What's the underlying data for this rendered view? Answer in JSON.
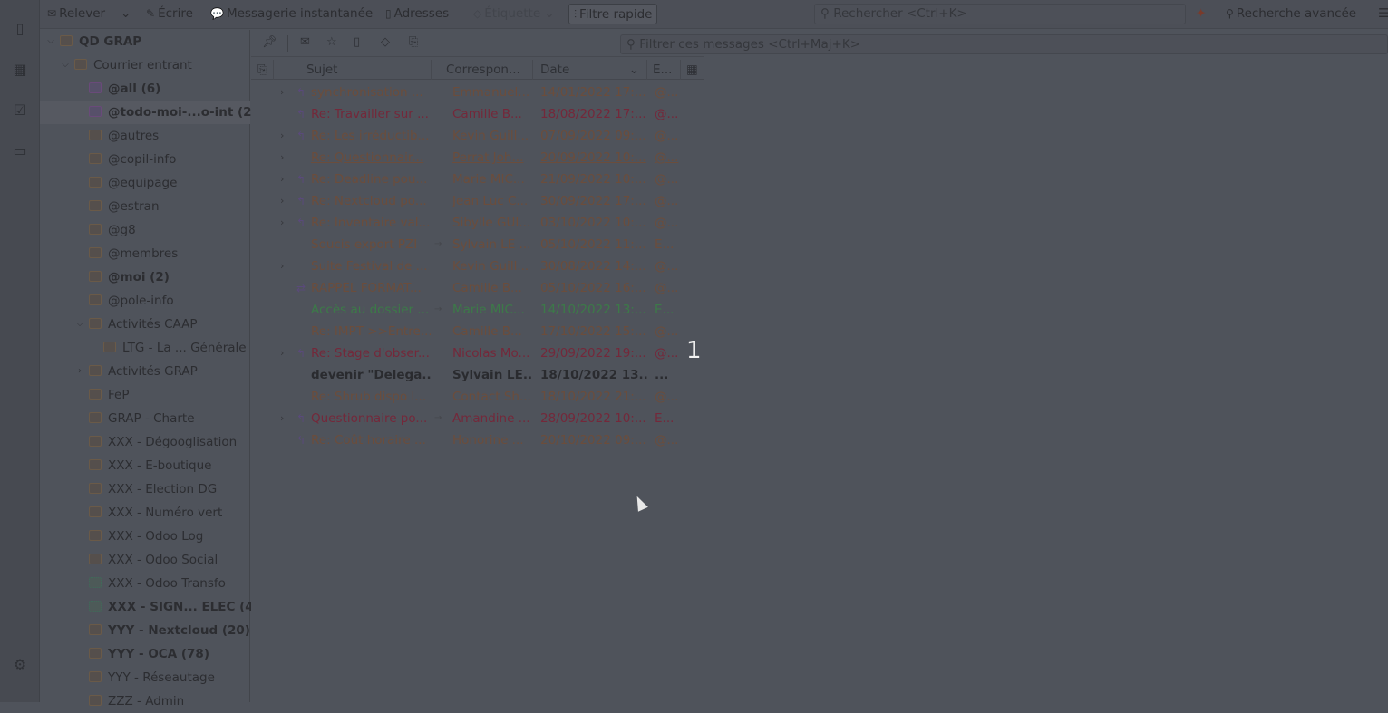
{
  "toolbar": {
    "get_mail": "Relever",
    "write": "Écrire",
    "chat": "Messagerie instantanée",
    "addresses": "Adresses",
    "tag": "Étiquette",
    "quick_filter": "Filtre rapide",
    "search_placeholder": "Rechercher <Ctrl+K>",
    "advanced_search": "Recherche avancée"
  },
  "folders": [
    {
      "label": "QD GRAP",
      "level": 0,
      "twisty": "open",
      "icon": "account",
      "bold": true
    },
    {
      "label": "Courrier entrant",
      "level": 1,
      "twisty": "open",
      "icon": "account"
    },
    {
      "label": "@all (6)",
      "level": 2,
      "icon": "purple",
      "bold": true
    },
    {
      "label": "@todo-moi-...o-int (2)",
      "level": 2,
      "icon": "purple",
      "bold": true,
      "selected": true
    },
    {
      "label": "@autres",
      "level": 2
    },
    {
      "label": "@copil-info",
      "level": 2
    },
    {
      "label": "@equipage",
      "level": 2
    },
    {
      "label": "@estran",
      "level": 2
    },
    {
      "label": "@g8",
      "level": 2
    },
    {
      "label": "@membres",
      "level": 2
    },
    {
      "label": "@moi (2)",
      "level": 2,
      "bold": true
    },
    {
      "label": "@pole-info",
      "level": 2
    },
    {
      "label": "Activités CAAP",
      "level": 2,
      "twisty": "open"
    },
    {
      "label": "LTG - La ... Générale",
      "level": 3
    },
    {
      "label": "Activités GRAP",
      "level": 2,
      "twisty": "closed"
    },
    {
      "label": "FeP",
      "level": 2
    },
    {
      "label": "GRAP - Charte",
      "level": 2
    },
    {
      "label": "XXX - Dégooglisation",
      "level": 2
    },
    {
      "label": "XXX - E-boutique",
      "level": 2
    },
    {
      "label": "XXX - Election DG",
      "level": 2
    },
    {
      "label": "XXX - Numéro vert",
      "level": 2
    },
    {
      "label": "XXX - Odoo Log",
      "level": 2
    },
    {
      "label": "XXX - Odoo Social",
      "level": 2
    },
    {
      "label": "XXX - Odoo Transfo",
      "level": 2,
      "icon": "green"
    },
    {
      "label": "XXX - SIGN... ELEC (4)",
      "level": 2,
      "icon": "green",
      "bold": true
    },
    {
      "label": "YYY - Nextcloud (20)",
      "level": 2,
      "bold": true
    },
    {
      "label": "YYY - OCA (78)",
      "level": 2,
      "bold": true
    },
    {
      "label": "YYY - Réseautage",
      "level": 2
    },
    {
      "label": "ZZZ - Admin",
      "level": 2
    }
  ],
  "list": {
    "filter_placeholder": "Filtrer ces messages <Ctrl+Maj+K>",
    "columns": {
      "subject": "Sujet",
      "correspondent": "Correspon...",
      "date": "Date",
      "email": "E..."
    },
    "rows": [
      {
        "subject": "synchronisation ...",
        "correspondent": "Emmanuel...",
        "date": "14/01/2022 17:...",
        "email": "@...",
        "thread": true,
        "status": "replied"
      },
      {
        "subject": "Re: Travailler sur ...",
        "correspondent": "Camille B...",
        "date": "18/08/2022 17:...",
        "email": "@...",
        "status": "replied",
        "style": "red"
      },
      {
        "subject": "Re: Les irréductib...",
        "correspondent": "Kevin Guill...",
        "date": "07/09/2022 09:...",
        "email": "@...",
        "thread": true,
        "status": "replied"
      },
      {
        "subject": "Re: Questionnair...",
        "correspondent": "Perrat Joh...",
        "date": "20/09/2022 10:...",
        "email": "@...",
        "thread": true,
        "style": "under"
      },
      {
        "subject": "Re: Deadline pou...",
        "correspondent": "Marie MIC...",
        "date": "21/09/2022 10:...",
        "email": "@...",
        "thread": true,
        "status": "replied"
      },
      {
        "subject": "Re: Nextcloud po...",
        "correspondent": "Jean Luc C...",
        "date": "30/09/2022 17:...",
        "email": "@...",
        "thread": true,
        "status": "replied"
      },
      {
        "subject": "Re: Inventaire val...",
        "correspondent": "Sibylle GUI...",
        "date": "03/10/2022 10:...",
        "email": "@...",
        "thread": true,
        "status": "replied"
      },
      {
        "subject": "Soucis export PZI",
        "correspondent": "Sylvain LE ...",
        "date": "05/10/2022 11:...",
        "email": "E...",
        "arrow": true
      },
      {
        "subject": "Suite Festival de ...",
        "correspondent": "Kevin Guill...",
        "date": "30/08/2022 14:...",
        "email": "@...",
        "thread": true
      },
      {
        "subject": "RAPPEL FORMAT...",
        "correspondent": "Camille B...",
        "date": "05/10/2022 16:...",
        "email": "@...",
        "status": "forwarded"
      },
      {
        "subject": "Accès au dossier ...",
        "correspondent": "Marie MIC...",
        "date": "14/10/2022 13:...",
        "email": "E...",
        "arrow": true,
        "style": "green"
      },
      {
        "subject": "Re: IMPT >>Entre...",
        "correspondent": "Camille B...",
        "date": "17/10/2022 15:...",
        "email": "@..."
      },
      {
        "subject": "Re: Stage d'obser...",
        "correspondent": "Nicolas Mo...",
        "date": "29/09/2022 19:...",
        "email": "@...",
        "thread": true,
        "status": "replied",
        "style": "red"
      },
      {
        "subject": "devenir \"Delega...",
        "correspondent": "Sylvain LE...",
        "date": "18/10/2022 13...",
        "email": "...",
        "style": "bold"
      },
      {
        "subject": "Re: Shrub dispo l...",
        "correspondent": "Contact Sh...",
        "date": "18/10/2022 21:...",
        "email": "@..."
      },
      {
        "subject": "Questionnaire po...",
        "correspondent": "Amandine ...",
        "date": "28/09/2022 10:...",
        "email": "E...",
        "thread": true,
        "status": "replied",
        "arrow": true,
        "style": "red"
      },
      {
        "subject": "Re: Coût horaire ...",
        "correspondent": "Honorine ...",
        "date": "20/10/2022 09:...",
        "email": "@...",
        "status": "replied"
      }
    ]
  },
  "selection_count": "1"
}
